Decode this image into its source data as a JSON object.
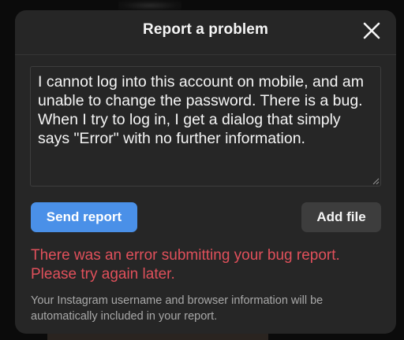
{
  "dialog": {
    "title": "Report a problem",
    "close_icon": "close-icon"
  },
  "report": {
    "text": "I cannot log into this account on mobile, and am unable to change the password. There is a bug. When I try to log in, I get a dialog that simply says \"Error\" with no further information."
  },
  "actions": {
    "send_label": "Send report",
    "add_file_label": "Add file"
  },
  "messages": {
    "error": "There was an error submitting your bug report. Please try again later.",
    "info": "Your Instagram username and browser information will be automatically included in your report."
  },
  "colors": {
    "modal_bg": "#262626",
    "primary_button": "#4a90e8",
    "secondary_button": "#3d3d3d",
    "error_text": "#e0505b",
    "muted_text": "#a8a8a8"
  }
}
